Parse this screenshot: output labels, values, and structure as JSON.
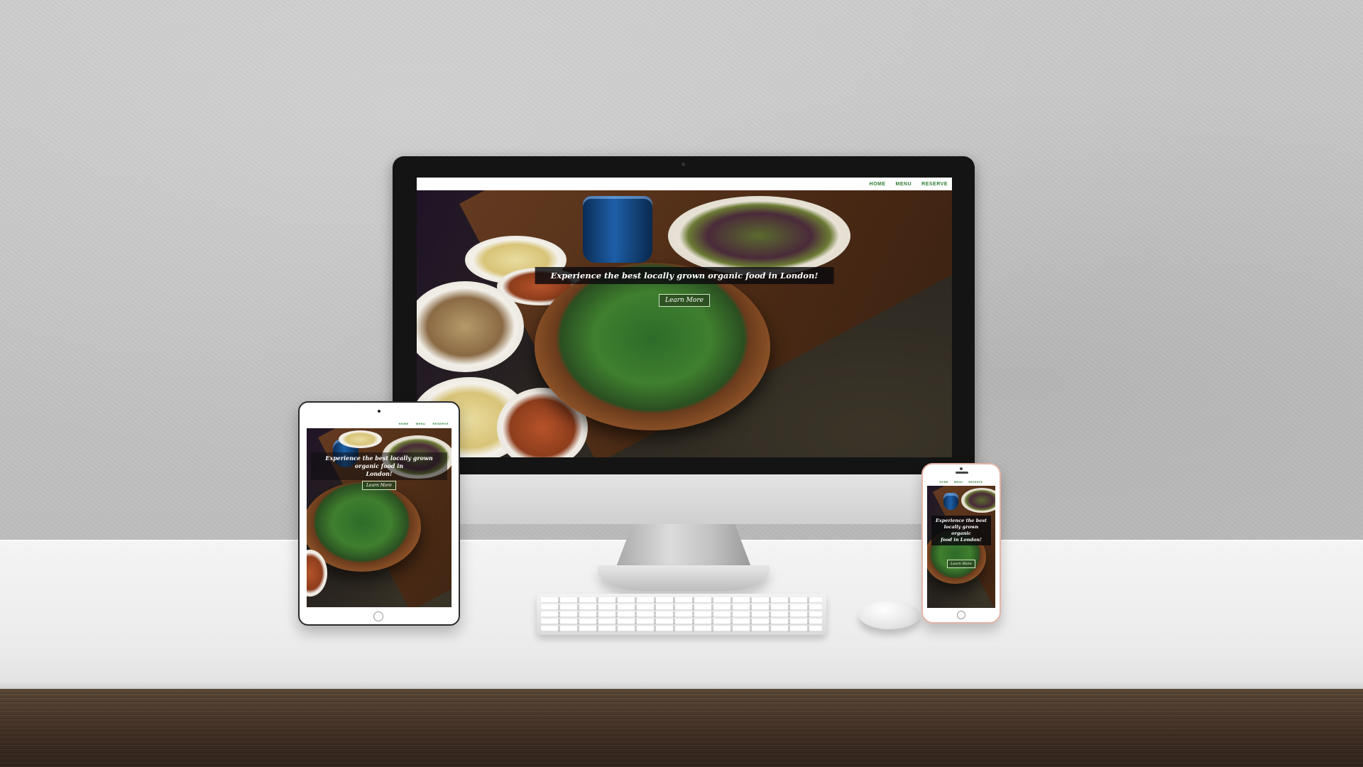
{
  "website": {
    "nav": [
      "HOME",
      "MENU",
      "RESERVE"
    ],
    "headline": "Experience the best locally grown organic food in London!",
    "headline_tablet": [
      "Experience the best locally grown organic food in",
      "London!"
    ],
    "headline_phone": [
      "Experience the best",
      "locally grown organic",
      "food in London!"
    ],
    "button_label": "Learn More",
    "nav_color": "#2e7d32",
    "button_border_color": "#cfe6c4"
  },
  "devices": {
    "desktop": "monitor",
    "tablet": "tablet",
    "phone": "phone"
  },
  "icons": {
    "webcam": "webcam-icon",
    "home_button": "home-button-icon",
    "speaker": "speaker-icon"
  }
}
